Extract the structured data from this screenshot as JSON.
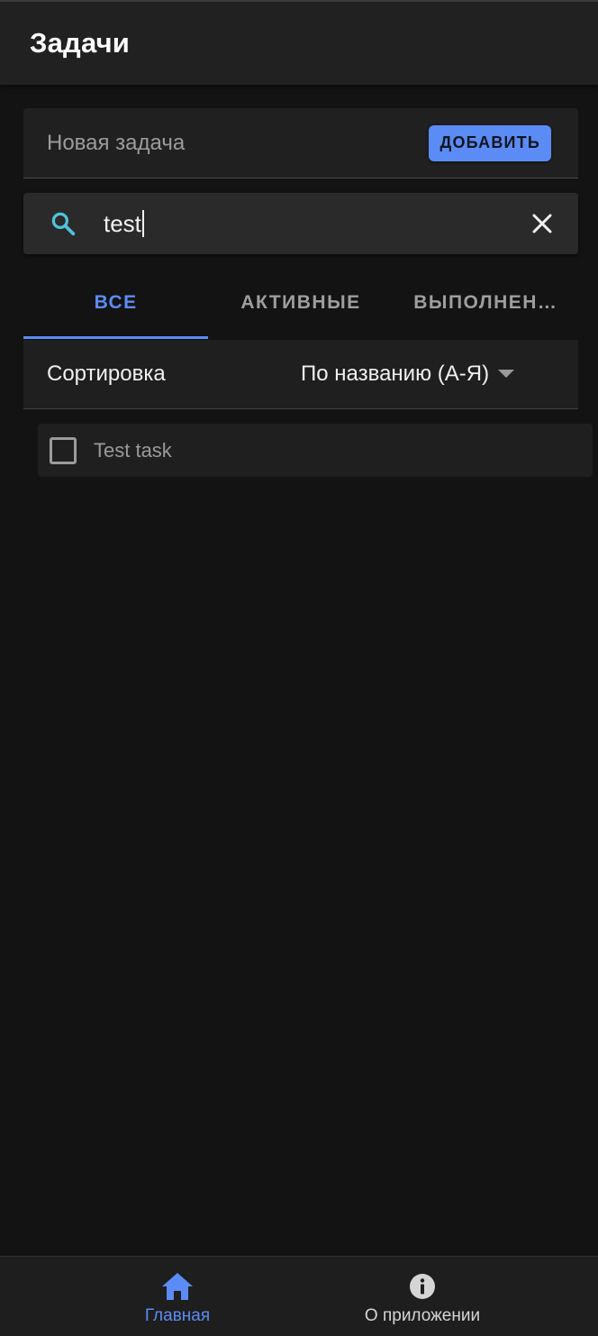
{
  "colors": {
    "accent": "#5b8cf5",
    "background": "#131313",
    "surface": "#202020",
    "search_icon": "#4fc3d9"
  },
  "appbar": {
    "title": "Задачи"
  },
  "new_task": {
    "placeholder": "Новая задача",
    "add_label": "ДОБАВИТЬ"
  },
  "search": {
    "value": "test",
    "icon": "search-icon",
    "clear_icon": "close-icon"
  },
  "tabs": [
    {
      "label": "ВСЕ",
      "active": true
    },
    {
      "label": "АКТИВНЫЕ",
      "active": false
    },
    {
      "label": "ВЫПОЛНЕН…",
      "active": false
    }
  ],
  "sort": {
    "label": "Сортировка",
    "value": "По названию (А-Я)",
    "icon": "caret-down-icon"
  },
  "tasks": [
    {
      "title": "Test task",
      "done": false
    }
  ],
  "bottom_nav": {
    "items": [
      {
        "label": "Главная",
        "icon": "home-icon",
        "active": true
      },
      {
        "label": "О приложении",
        "icon": "info-icon",
        "active": false
      }
    ]
  }
}
